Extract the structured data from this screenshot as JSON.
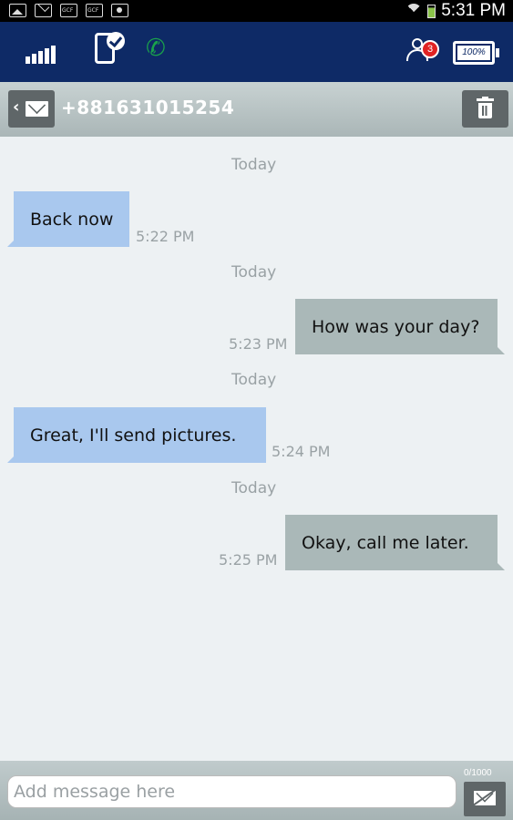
{
  "status_bar": {
    "time": "5:31 PM",
    "notification_icons": [
      "image-icon",
      "mail-icon",
      "gcf-icon",
      "gcf-icon",
      "camera-icon"
    ],
    "wifi": "wifi-icon",
    "battery": "battery-charging-icon"
  },
  "app_bar": {
    "signal_icon": "signal-strength-icon",
    "device_check_icon": "device-check-icon",
    "call_icon": "phone-call-icon",
    "contacts_icon": "contacts-icon",
    "contacts_badge": "3",
    "battery_level": "100%",
    "colors": {
      "background": "#0e2a66",
      "call_green": "#1aa24b",
      "badge_red": "#e02323"
    }
  },
  "conversation": {
    "back_icon": "back-envelope-icon",
    "number": "+881631015254",
    "delete_icon": "trash-icon"
  },
  "messages": [
    {
      "day": "Today",
      "direction": "incoming",
      "text": "Back now",
      "time": "5:22 PM"
    },
    {
      "day": "Today",
      "direction": "outgoing",
      "text": "How was your day?",
      "time": "5:23 PM"
    },
    {
      "day": "Today",
      "direction": "incoming",
      "text": "Great, I'll send pictures.",
      "time": "5:24 PM"
    },
    {
      "day": "Today",
      "direction": "outgoing",
      "text": "Okay, call me later.",
      "time": "5:25 PM"
    }
  ],
  "composer": {
    "placeholder": "Add message here",
    "value": "",
    "char_count": "0/1000",
    "send_icon": "send-envelope-icon"
  },
  "colors": {
    "incoming_bubble": "#a9c8ee",
    "outgoing_bubble": "#aab8b8",
    "chat_background": "#edf1f3"
  }
}
